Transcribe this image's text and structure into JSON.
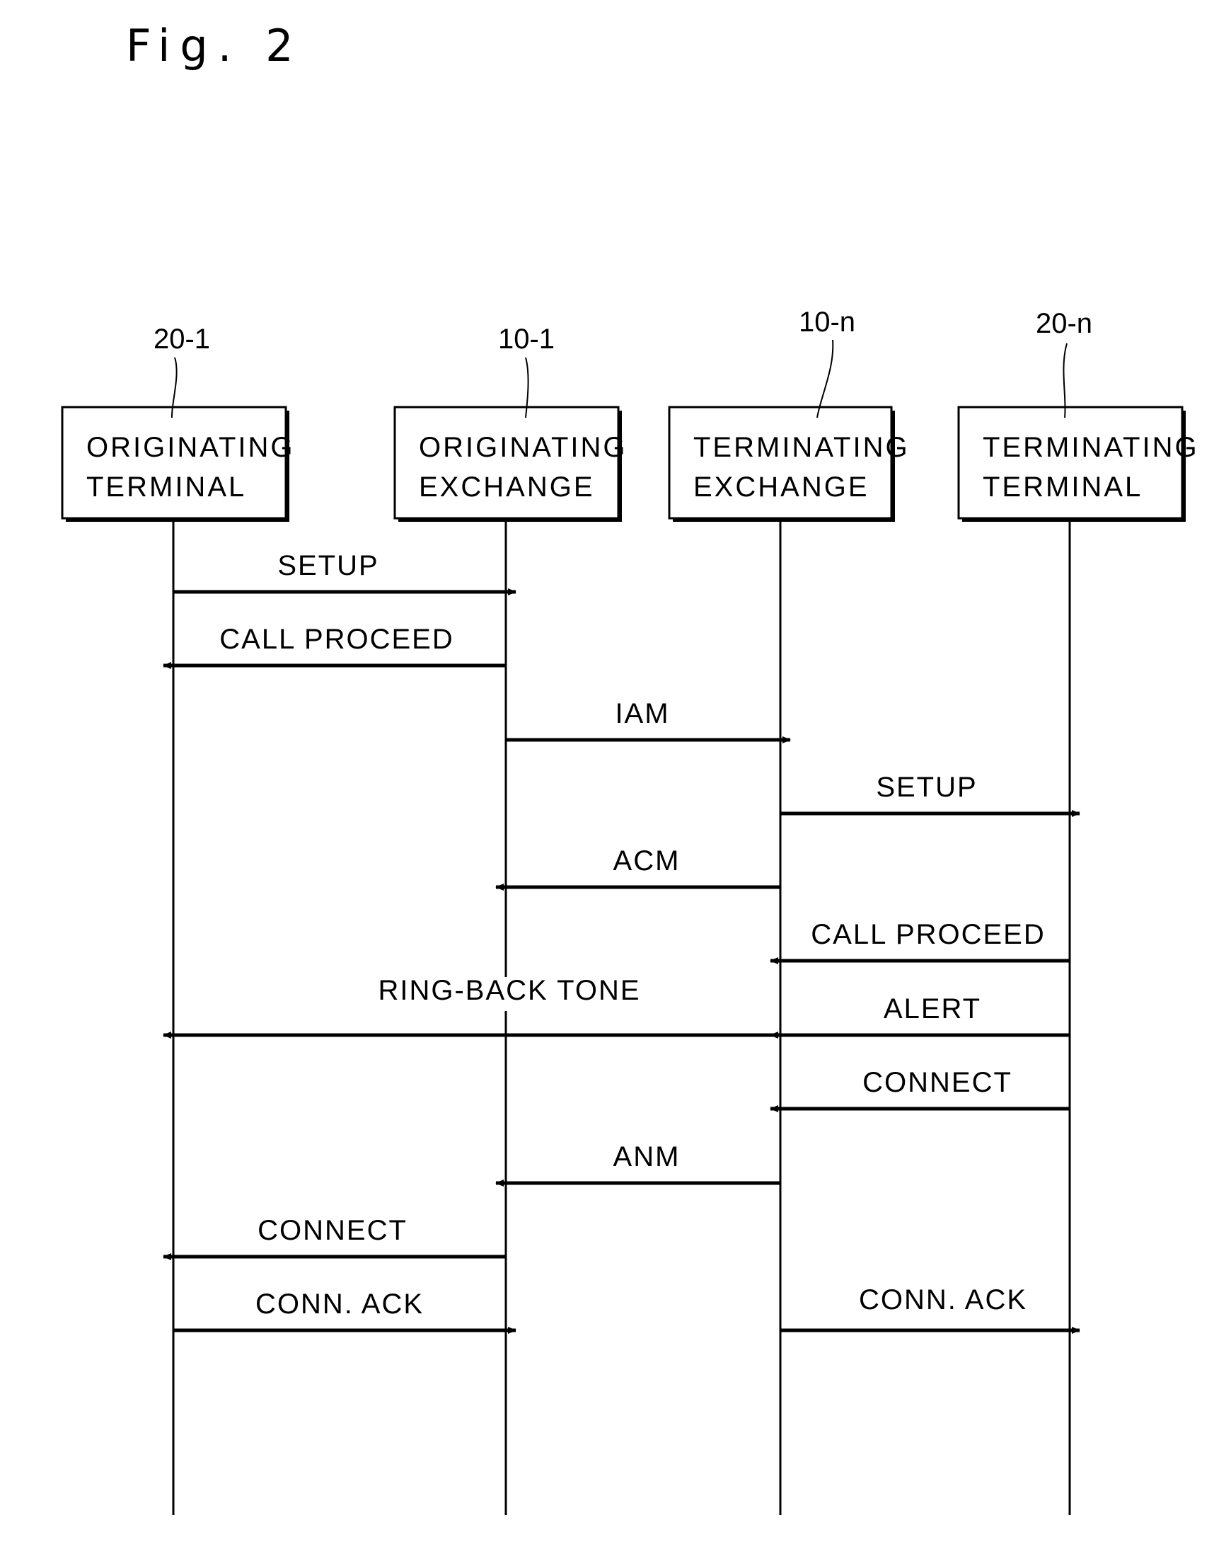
{
  "figure": {
    "title": "Fig. 2"
  },
  "participants": [
    {
      "id": "orig_terminal",
      "ref": "20-1",
      "line1": "ORIGINATING",
      "line2": "TERMINAL"
    },
    {
      "id": "orig_exchange",
      "ref": "10-1",
      "line1": "ORIGINATING",
      "line2": "EXCHANGE"
    },
    {
      "id": "term_exchange",
      "ref": "10-n",
      "line1": "TERMINATING",
      "line2": "EXCHANGE"
    },
    {
      "id": "term_terminal",
      "ref": "20-n",
      "line1": "TERMINATING",
      "line2": "TERMINAL"
    }
  ],
  "messages": [
    {
      "label": "SETUP",
      "from": 0,
      "to": 1
    },
    {
      "label": "CALL PROCEED",
      "from": 1,
      "to": 0
    },
    {
      "label": "IAM",
      "from": 1,
      "to": 2
    },
    {
      "label": "SETUP",
      "from": 2,
      "to": 3
    },
    {
      "label": "ACM",
      "from": 2,
      "to": 1
    },
    {
      "label": "CALL PROCEED",
      "from": 3,
      "to": 2
    },
    {
      "label": "RING-BACK TONE",
      "from": 2,
      "to": 0
    },
    {
      "label": "ALERT",
      "from": 3,
      "to": 2
    },
    {
      "label": "CONNECT",
      "from": 3,
      "to": 2
    },
    {
      "label": "ANM",
      "from": 2,
      "to": 1
    },
    {
      "label": "CONNECT",
      "from": 1,
      "to": 0
    },
    {
      "label": "CONN. ACK",
      "from": 0,
      "to": 1
    },
    {
      "label": "CONN. ACK",
      "from": 2,
      "to": 3
    }
  ],
  "colors": {
    "ink": "#000000",
    "background": "#ffffff"
  }
}
